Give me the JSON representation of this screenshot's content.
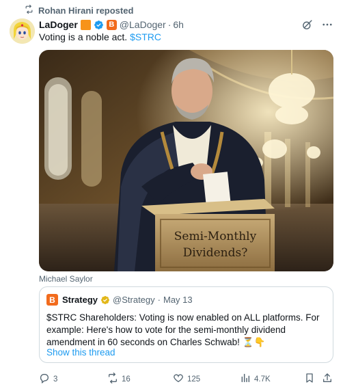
{
  "repost": {
    "text": "Rohan Hirani reposted"
  },
  "tweet": {
    "author_name": "LaDoger",
    "b_badge": "B",
    "handle": "@LaDoger",
    "separator": "·",
    "time": "6h",
    "text_plain": "Voting is a noble act. ",
    "text_cashtag": "$STRC",
    "media_caption": "Michael Saylor",
    "media_sign_line1": "Semi-Monthly",
    "media_sign_line2": "Dividends?"
  },
  "quote": {
    "logo_letter": "B",
    "author_name": "Strategy",
    "handle": "@Strategy",
    "separator": "·",
    "date": "May 13",
    "body": "$STRC Shareholders: Voting is now enabled on ALL platforms. For example: Here's how to vote for the semi-monthly dividend amendment in 60 seconds on Charles Schwab! ⏳👇",
    "show_thread": "Show this thread"
  },
  "actions": {
    "replies": "3",
    "reposts": "16",
    "likes": "125",
    "views": "4.7K"
  },
  "colors": {
    "accent": "#1d9bf0",
    "muted": "#536471",
    "border": "#cfd9de",
    "brand_orange": "#f26b1d",
    "bitcoin_orange": "#f7931a"
  }
}
